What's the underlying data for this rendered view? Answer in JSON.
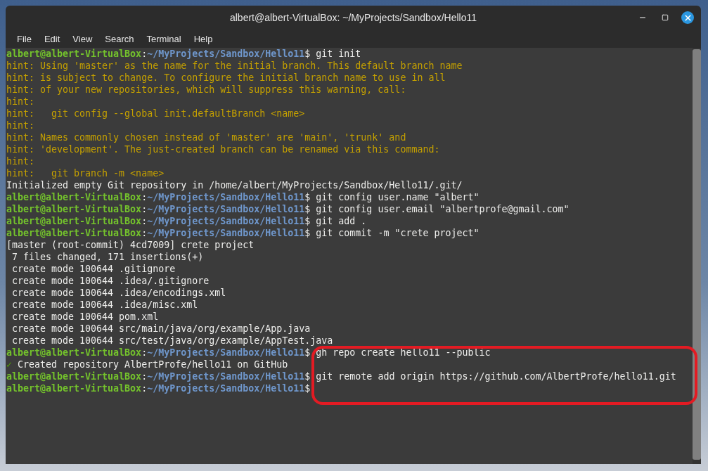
{
  "window": {
    "title": "albert@albert-VirtualBox: ~/MyProjects/Sandbox/Hello11"
  },
  "menu": [
    "File",
    "Edit",
    "View",
    "Search",
    "Terminal",
    "Help"
  ],
  "terminal": {
    "lines": [
      {
        "kind": "prompt",
        "user": "albert@albert-VirtualBox",
        "colon": ":",
        "path": "~/MyProjects/Sandbox/Hello11",
        "command": "$ git init"
      },
      {
        "kind": "hint",
        "text": "hint: Using 'master' as the name for the initial branch. This default branch name"
      },
      {
        "kind": "hint",
        "text": "hint: is subject to change. To configure the initial branch name to use in all"
      },
      {
        "kind": "hint",
        "text": "hint: of your new repositories, which will suppress this warning, call:"
      },
      {
        "kind": "hint",
        "text": "hint:"
      },
      {
        "kind": "hint",
        "text": "hint:   git config --global init.defaultBranch <name>"
      },
      {
        "kind": "hint",
        "text": "hint:"
      },
      {
        "kind": "hint",
        "text": "hint: Names commonly chosen instead of 'master' are 'main', 'trunk' and"
      },
      {
        "kind": "hint",
        "text": "hint: 'development'. The just-created branch can be renamed via this command:"
      },
      {
        "kind": "hint",
        "text": "hint:"
      },
      {
        "kind": "hint",
        "text": "hint:   git branch -m <name>"
      },
      {
        "kind": "output",
        "text": "Initialized empty Git repository in /home/albert/MyProjects/Sandbox/Hello11/.git/"
      },
      {
        "kind": "prompt",
        "user": "albert@albert-VirtualBox",
        "colon": ":",
        "path": "~/MyProjects/Sandbox/Hello11",
        "command": "$ git config user.name \"albert\""
      },
      {
        "kind": "prompt",
        "user": "albert@albert-VirtualBox",
        "colon": ":",
        "path": "~/MyProjects/Sandbox/Hello11",
        "command": "$ git config user.email \"albertprofe@gmail.com\""
      },
      {
        "kind": "prompt",
        "user": "albert@albert-VirtualBox",
        "colon": ":",
        "path": "~/MyProjects/Sandbox/Hello11",
        "command": "$ git add ."
      },
      {
        "kind": "prompt",
        "user": "albert@albert-VirtualBox",
        "colon": ":",
        "path": "~/MyProjects/Sandbox/Hello11",
        "command": "$ git commit -m \"crete project\""
      },
      {
        "kind": "output",
        "text": "[master (root-commit) 4cd7009] crete project"
      },
      {
        "kind": "output",
        "text": " 7 files changed, 171 insertions(+)"
      },
      {
        "kind": "output",
        "text": " create mode 100644 .gitignore"
      },
      {
        "kind": "output",
        "text": " create mode 100644 .idea/.gitignore"
      },
      {
        "kind": "output",
        "text": " create mode 100644 .idea/encodings.xml"
      },
      {
        "kind": "output",
        "text": " create mode 100644 .idea/misc.xml"
      },
      {
        "kind": "output",
        "text": " create mode 100644 pom.xml"
      },
      {
        "kind": "output",
        "text": " create mode 100644 src/main/java/org/example/App.java"
      },
      {
        "kind": "output",
        "text": " create mode 100644 src/test/java/org/example/AppTest.java"
      },
      {
        "kind": "prompt",
        "user": "albert@albert-VirtualBox",
        "colon": ":",
        "path": "~/MyProjects/Sandbox/Hello11",
        "command": "$ gh repo create hello11 --public"
      },
      {
        "kind": "success",
        "mark": "✓",
        "text": " Created repository AlbertProfe/hello11 on GitHub"
      },
      {
        "kind": "prompt",
        "user": "albert@albert-VirtualBox",
        "colon": ":",
        "path": "~/MyProjects/Sandbox/Hello11",
        "command": "$ git remote add origin https://github.com/AlbertProfe/hello11.git"
      },
      {
        "kind": "prompt",
        "user": "albert@albert-VirtualBox",
        "colon": ":",
        "path": "~/MyProjects/Sandbox/Hello11",
        "command": "$"
      }
    ]
  }
}
